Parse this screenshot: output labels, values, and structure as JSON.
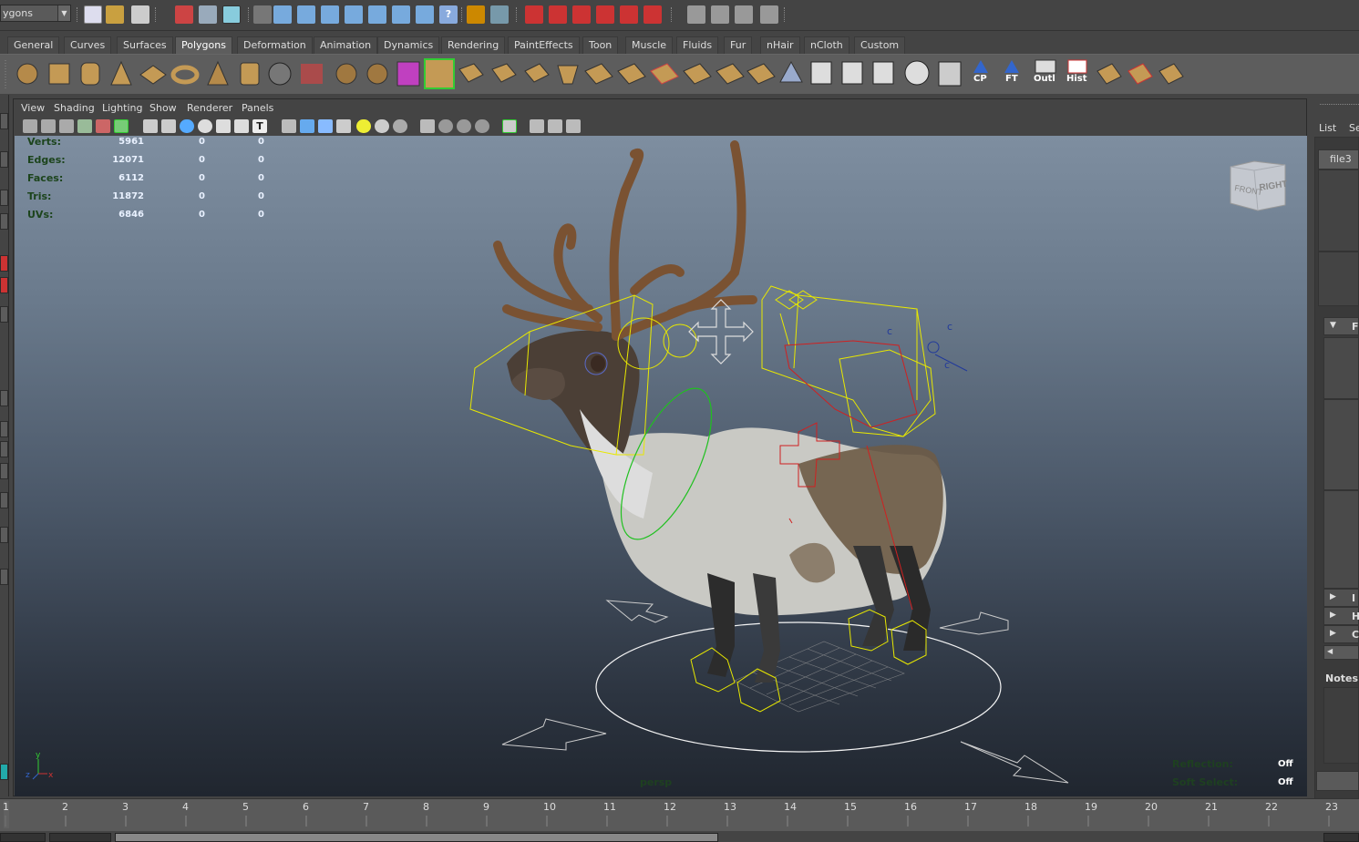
{
  "status_line": {
    "mode_select": "ygons"
  },
  "shelf_tabs": [
    "General",
    "Curves",
    "Surfaces",
    "Polygons",
    "Deformation",
    "Animation",
    "Dynamics",
    "Rendering",
    "PaintEffects",
    "Toon",
    "Muscle",
    "Fluids",
    "Fur",
    "nHair",
    "nCloth",
    "Custom"
  ],
  "shelf_active_tab": "Polygons",
  "shelf_labels": {
    "cp": "CP",
    "ft": "FT",
    "outl": "Outl",
    "hist": "Hist"
  },
  "panel_menu": [
    "View",
    "Shading",
    "Lighting",
    "Show",
    "Renderer",
    "Panels"
  ],
  "hud": {
    "rows": [
      {
        "label": "Verts:",
        "values": [
          "5961",
          "0",
          "0"
        ]
      },
      {
        "label": "Edges:",
        "values": [
          "12071",
          "0",
          "0"
        ]
      },
      {
        "label": "Faces:",
        "values": [
          "6112",
          "0",
          "0"
        ]
      },
      {
        "label": "Tris:",
        "values": [
          "11872",
          "0",
          "0"
        ]
      },
      {
        "label": "UVs:",
        "values": [
          "6846",
          "0",
          "0"
        ]
      }
    ],
    "camera": "persp",
    "reflection_label": "Reflection:",
    "reflection_value": "Off",
    "soft_select_label": "Soft Select:",
    "soft_select_value": "Off",
    "axis_y": "y",
    "axis_x": "x",
    "axis_z": "z"
  },
  "viewcube": {
    "front": "FRONT",
    "right": "RIGHT"
  },
  "rig_labels": [
    "c",
    "c",
    "c"
  ],
  "right_panel": {
    "list": "List",
    "se": "Se",
    "file_tab": "file3",
    "f": "F",
    "i": "I",
    "h": "H",
    "c": "C",
    "notes": "Notes:"
  },
  "timeline": {
    "frames": [
      "1",
      "2",
      "3",
      "4",
      "5",
      "6",
      "7",
      "8",
      "9",
      "10",
      "11",
      "12",
      "13",
      "14",
      "15",
      "16",
      "17",
      "18",
      "19",
      "20",
      "21",
      "22",
      "23"
    ]
  },
  "colors": {
    "accent_active_tab": "#5d5d5d",
    "rig_yellow": "#e8e800",
    "rig_red": "#d02020",
    "rig_green": "#20c020"
  }
}
